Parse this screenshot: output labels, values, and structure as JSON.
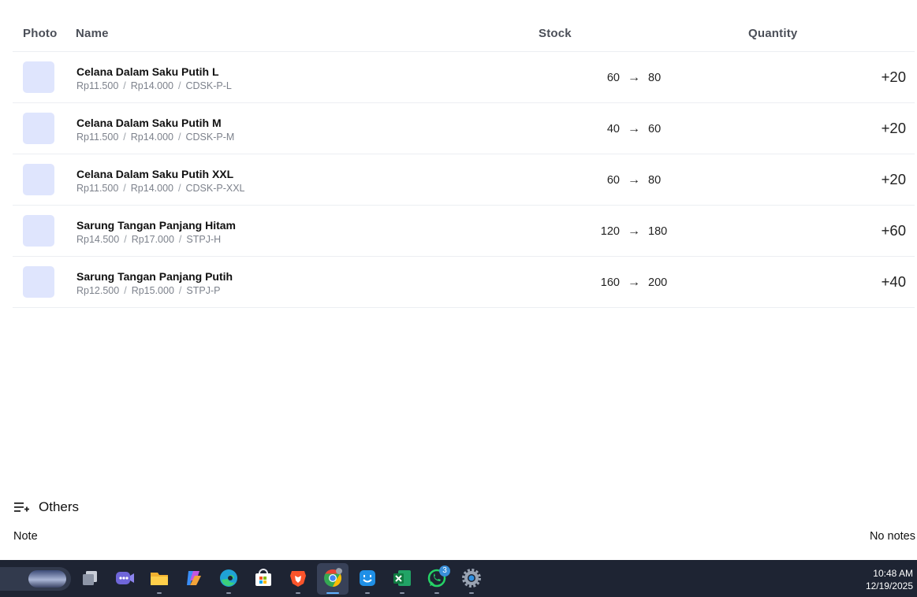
{
  "table": {
    "headers": {
      "photo": "Photo",
      "name": "Name",
      "stock": "Stock",
      "quantity": "Quantity"
    },
    "rows": [
      {
        "name": "Celana Dalam Saku Putih L",
        "price_buy": "Rp11.500",
        "price_sell": "Rp14.000",
        "sku": "CDSK-P-L",
        "stock_from": "60",
        "stock_to": "80",
        "quantity": "+20"
      },
      {
        "name": "Celana Dalam Saku Putih M",
        "price_buy": "Rp11.500",
        "price_sell": "Rp14.000",
        "sku": "CDSK-P-M",
        "stock_from": "40",
        "stock_to": "60",
        "quantity": "+20"
      },
      {
        "name": "Celana Dalam Saku Putih XXL",
        "price_buy": "Rp11.500",
        "price_sell": "Rp14.000",
        "sku": "CDSK-P-XXL",
        "stock_from": "60",
        "stock_to": "80",
        "quantity": "+20"
      },
      {
        "name": "Sarung Tangan Panjang Hitam",
        "price_buy": "Rp14.500",
        "price_sell": "Rp17.000",
        "sku": "STPJ-H",
        "stock_from": "120",
        "stock_to": "180",
        "quantity": "+60"
      },
      {
        "name": "Sarung Tangan Panjang Putih",
        "price_buy": "Rp12.500",
        "price_sell": "Rp15.000",
        "sku": "STPJ-P",
        "stock_from": "160",
        "stock_to": "200",
        "quantity": "+40"
      }
    ],
    "separator": "/",
    "arrow": "→"
  },
  "others": {
    "label": "Others",
    "icon": "list-add-icon"
  },
  "note": {
    "label": "Note",
    "value": "No notes"
  },
  "taskbar": {
    "apps": [
      "task-view",
      "meet",
      "file-explorer",
      "copilot",
      "edge",
      "store",
      "brave",
      "chrome",
      "finder",
      "excel",
      "whatsapp",
      "settings"
    ],
    "whatsapp_badge": "3",
    "time": "10:48 AM",
    "date": "12/19/2025"
  },
  "colors": {
    "photo_placeholder": "#dfe5fd",
    "taskbar": "#1e2433",
    "muted_text": "#7d828c"
  }
}
